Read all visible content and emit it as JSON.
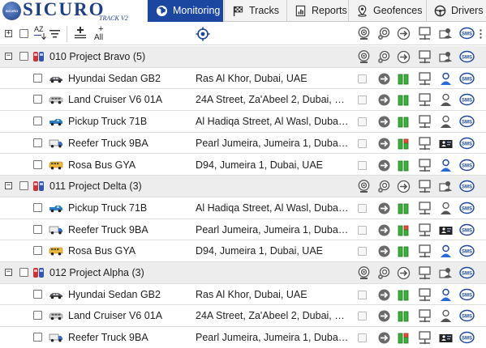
{
  "app": {
    "logo_badge": "SICURO",
    "logo_word": "SICURO",
    "logo_sub": "TRACK V2",
    "accent": "#1c47a0"
  },
  "nav": {
    "tabs": [
      {
        "label": "Monitoring",
        "icon": "globe-icon",
        "active": true
      },
      {
        "label": "Tracks",
        "icon": "flag-icon",
        "active": false
      },
      {
        "label": "Reports",
        "icon": "report-icon",
        "active": false
      },
      {
        "label": "Geofences",
        "icon": "geofence-icon",
        "active": false
      },
      {
        "label": "Drivers",
        "icon": "steering-wheel-icon",
        "active": false
      }
    ]
  },
  "toolbar": {
    "sort_label": "AZ",
    "all_label": "All"
  },
  "groups": [
    {
      "name": "010 Project Bravo (5)",
      "vehicles": [
        {
          "name": "Hyundai Sedan GB2",
          "address": "Ras Al Khor, Dubai, UAE",
          "type": "sedan-icon",
          "status": "moving"
        },
        {
          "name": "Land Cruiser V6 01A",
          "address": "24A Street, Za'Abeel 2, Dubai, UAE",
          "type": "suv-icon",
          "status": "moving"
        },
        {
          "name": "Pickup Truck 71B",
          "address": "Al Hadiqa Street, Al Wasl, Dubai, ...",
          "type": "pickup-icon",
          "status": "moving"
        },
        {
          "name": "Reefer Truck 9BA",
          "address": "Pearl Jumeira, Jumeira 1, Dubai, ...",
          "type": "truck-icon",
          "status": "stopped"
        },
        {
          "name": "Rosa Bus GYA",
          "address": "D94, Jumeira 1, Dubai, UAE",
          "type": "bus-icon",
          "status": "moving"
        }
      ]
    },
    {
      "name": "011 Project Delta (3)",
      "vehicles": [
        {
          "name": "Pickup Truck 71B",
          "address": "Al Hadiqa Street, Al Wasl, Dubai, ...",
          "type": "pickup-icon",
          "status": "moving"
        },
        {
          "name": "Reefer Truck 9BA",
          "address": "Pearl Jumeira, Jumeira 1, Dubai, ...",
          "type": "truck-icon",
          "status": "stopped"
        },
        {
          "name": "Rosa Bus GYA",
          "address": "D94, Jumeira 1, Dubai, UAE",
          "type": "bus-icon",
          "status": "moving"
        }
      ]
    },
    {
      "name": "012 Project Alpha (3)",
      "vehicles": [
        {
          "name": "Hyundai Sedan GB2",
          "address": "Ras Al Khor, Dubai, UAE",
          "type": "sedan-icon",
          "status": "moving"
        },
        {
          "name": "Land Cruiser V6 01A",
          "address": "24A Street, Za'Abeel 2, Dubai, UAE",
          "type": "suv-icon",
          "status": "moving"
        },
        {
          "name": "Reefer Truck 9BA",
          "address": "Pearl Jumeira, Jumeira 1, Dubai, ...",
          "type": "truck-icon",
          "status": "stopped"
        }
      ]
    }
  ]
}
